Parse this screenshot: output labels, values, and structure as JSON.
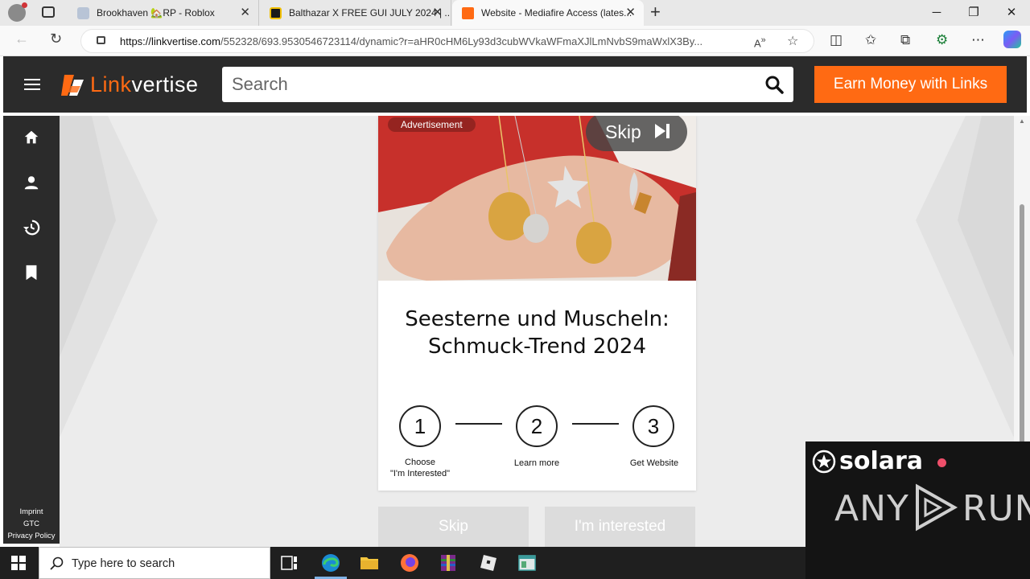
{
  "browser": {
    "tabs": [
      {
        "title": "Brookhaven 🏡RP - Roblox",
        "active": false
      },
      {
        "title": "Balthazar X FREE GUI JULY 2024 | ...",
        "active": false
      },
      {
        "title": "Website - Mediafire Access (lates...",
        "active": true
      }
    ],
    "url_host": "https://linkvertise.com",
    "url_rest": "/552328/693.9530546723114/dynamic?r=aHR0cHM6Ly93d3cubWVkaWFmaXJlLmNvbS9maWxlX3By...",
    "window_controls": [
      "─",
      "❐",
      "✕"
    ]
  },
  "linkvertise": {
    "logo_prefix": "Link",
    "logo_suffix": "vertise",
    "search_placeholder": "Search",
    "earn_button": "Earn Money with Links",
    "footer_links": [
      "Imprint",
      "GTC",
      "Privacy Policy"
    ],
    "accent_color": "#ff6a13"
  },
  "ad": {
    "label": "Advertisement",
    "skip_label": "Skip",
    "title_line1": "Seesterne und Muscheln:",
    "title_line2": "Schmuck-Trend 2024"
  },
  "steps": [
    {
      "number": "1",
      "label_line1": "Choose",
      "label_line2": "\"I'm Interested\""
    },
    {
      "number": "2",
      "label_line1": "Learn more",
      "label_line2": ""
    },
    {
      "number": "3",
      "label_line1": "Get Website",
      "label_line2": ""
    }
  ],
  "actions": {
    "skip": "Skip",
    "interested": "I'm interested"
  },
  "overlay": {
    "solara_text": "solara",
    "anyrun_left": "ANY",
    "anyrun_right": "RUN"
  },
  "taskbar": {
    "search_placeholder": "Type here to search"
  }
}
